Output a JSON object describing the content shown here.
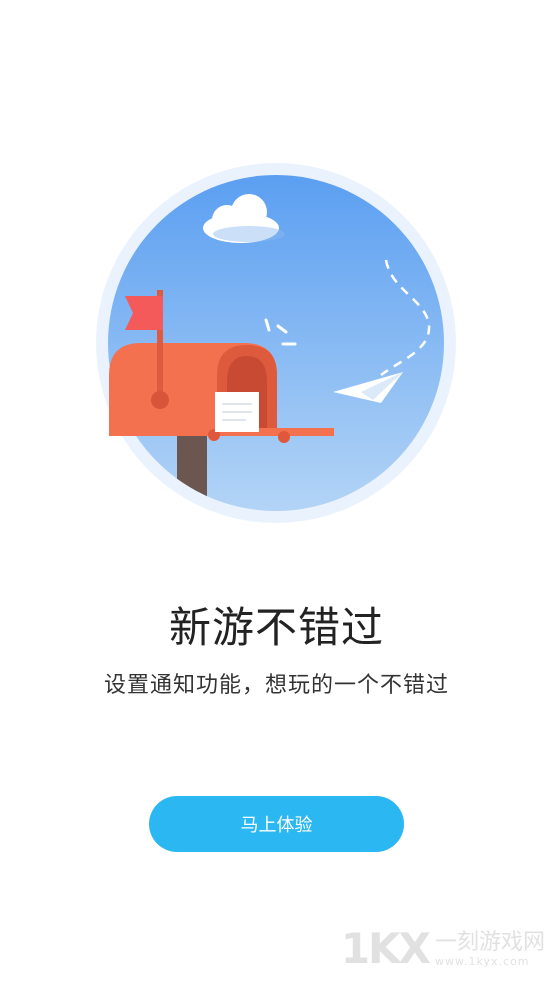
{
  "illustration": {
    "icons": [
      "cloud-icon",
      "flag-icon",
      "mailbox-icon",
      "letter-icon",
      "paper-plane-icon"
    ],
    "colors": {
      "sky_top": "#5fa3f2",
      "sky_bottom": "#a9cdf5",
      "ring": "#e8f2fc",
      "mailbox": "#f2704f",
      "mailbox_dark": "#d9553a",
      "flag": "#f45a5a",
      "post": "#6b5a55"
    }
  },
  "onboarding": {
    "title": "新游不错过",
    "subtitle": "设置通知功能，想玩的一个不错过",
    "cta_label": "马上体验"
  },
  "watermark": {
    "logo": "1KX",
    "site_name": "一刻游戏网",
    "url": "www.1kyx.com"
  }
}
